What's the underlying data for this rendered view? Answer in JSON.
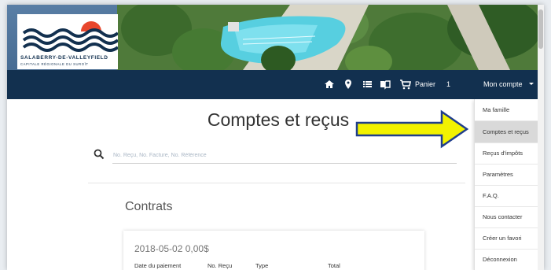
{
  "logo": {
    "line1": "SALABERRY-DE-VALLEYFIELD",
    "line2": "CAPITALE RÉGIONALE DU SUROÎT"
  },
  "nav": {
    "icons": [
      "home-icon",
      "map-pin-icon",
      "list-icon",
      "book-icon",
      "cart-icon",
      "chevron-down-icon"
    ],
    "cart_label": "Panier",
    "cart_count": "1",
    "account_label": "Mon compte"
  },
  "main": {
    "title": "Comptes et reçus",
    "search": {
      "placeholder": "No. Reçu, No. Facture, No. Référence",
      "value": ""
    },
    "section_title": "Contrats",
    "card": {
      "heading": "2018-05-02 0,00$",
      "columns": [
        "Date du paiement",
        "No. Reçu",
        "Type",
        "Total"
      ]
    }
  },
  "dropdown": {
    "items": [
      {
        "label": "Ma famille"
      },
      {
        "label": "Comptes et reçus",
        "active": true
      },
      {
        "label": "Reçus d'impôts"
      },
      {
        "label": "Paramètres"
      },
      {
        "label": "F.A.Q."
      },
      {
        "label": "Nous contacter"
      },
      {
        "label": "Créer un favori"
      },
      {
        "label": "Déconnexion"
      }
    ]
  },
  "colors": {
    "nav_bg": "#12304f",
    "arrow_fill": "#f2f200",
    "arrow_stroke": "#1f3e8c",
    "active_item_bg": "#d9d9d9",
    "logo_red": "#e8472d"
  }
}
